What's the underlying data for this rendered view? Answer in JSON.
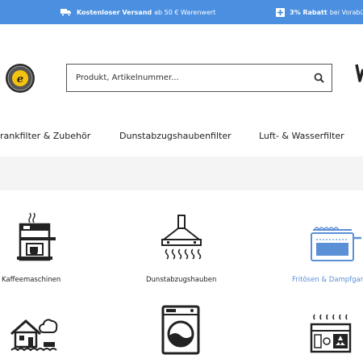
{
  "promo_bar": {
    "item1": {
      "strong": "Kostenloser Versand",
      "rest": "ab 50 € Warenwert",
      "icon": "truck-icon"
    },
    "item2": {
      "strong": "3% Rabatt",
      "rest": "bei Vorabü",
      "icon": "plus-box-icon"
    }
  },
  "header": {
    "trust_badge": "trusted-shops-badge",
    "search": {
      "placeholder": "Produkt, Artikelnummer..."
    }
  },
  "nav": {
    "items": [
      {
        "label": "rankfilter & Zubehör"
      },
      {
        "label": "Dunstabzugshaubenfilter"
      },
      {
        "label": "Luft- & Wasserfilter"
      }
    ]
  },
  "categories": [
    {
      "label": "Kaffeemaschinen",
      "icon": "coffee-machine-icon"
    },
    {
      "label": "Dunstabzugshauben",
      "icon": "cooker-hood-icon"
    },
    {
      "label": "Fritösen & Dampfgar",
      "icon": "fryer-icon",
      "active_color": "#5b8fd6"
    },
    {
      "label": "",
      "icon": "house-flood-icon"
    },
    {
      "label": "",
      "icon": "washing-machine-icon"
    },
    {
      "label": "",
      "icon": "control-panel-icon"
    }
  ],
  "colors": {
    "promo_bar": "#4a8fe0",
    "accent": "#5b8fd6"
  }
}
